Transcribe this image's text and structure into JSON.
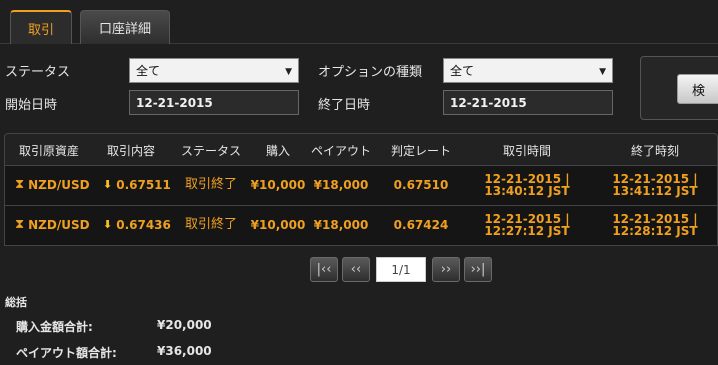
{
  "tabs": [
    {
      "label": "取引",
      "active": true
    },
    {
      "label": "口座詳細",
      "active": false
    }
  ],
  "filters": {
    "status_label": "ステータス",
    "status_value": "全て",
    "option_type_label": "オプションの種類",
    "option_type_value": "全て",
    "start_date_label": "開始日時",
    "start_date_value": "12-21-2015",
    "end_date_label": "終了日時",
    "end_date_value": "12-21-2015",
    "search_label": "検"
  },
  "table": {
    "headers": [
      "取引原資産",
      "取引内容",
      "ステータス",
      "購入",
      "ペイアウト",
      "判定レート",
      "取引時間",
      "終了時刻"
    ],
    "rows": [
      {
        "asset": "NZD/USD",
        "content": "0.67511",
        "status": "取引終了",
        "purchase": "¥10,000",
        "payout": "¥18,000",
        "rate": "0.67510",
        "trade_time_line1": "12-21-2015 |",
        "trade_time_line2": "13:40:12 JST",
        "end_time_line1": "12-21-2015 |",
        "end_time_line2": "13:41:12 JST"
      },
      {
        "asset": "NZD/USD",
        "content": "0.67436",
        "status": "取引終了",
        "purchase": "¥10,000",
        "payout": "¥18,000",
        "rate": "0.67424",
        "trade_time_line1": "12-21-2015 |",
        "trade_time_line2": "12:27:12 JST",
        "end_time_line1": "12-21-2015 |",
        "end_time_line2": "12:28:12 JST"
      }
    ]
  },
  "pager": {
    "first": "|‹‹",
    "prev": "‹‹",
    "page": "1/1",
    "next": "››",
    "last": "››|"
  },
  "summary": {
    "title": "総括",
    "purchase_total_label": "購入金額合計:",
    "purchase_total_value": "¥20,000",
    "payout_total_label": "ペイアウト額合計:",
    "payout_total_value": "¥36,000"
  },
  "colors": {
    "accent": "#f0a020",
    "background": "#1f1f1f",
    "row_background": "#151515"
  },
  "icons": {
    "asset": "hourglass-icon",
    "direction": "down-arrow-icon",
    "dropdown": "chevron-down-icon"
  }
}
